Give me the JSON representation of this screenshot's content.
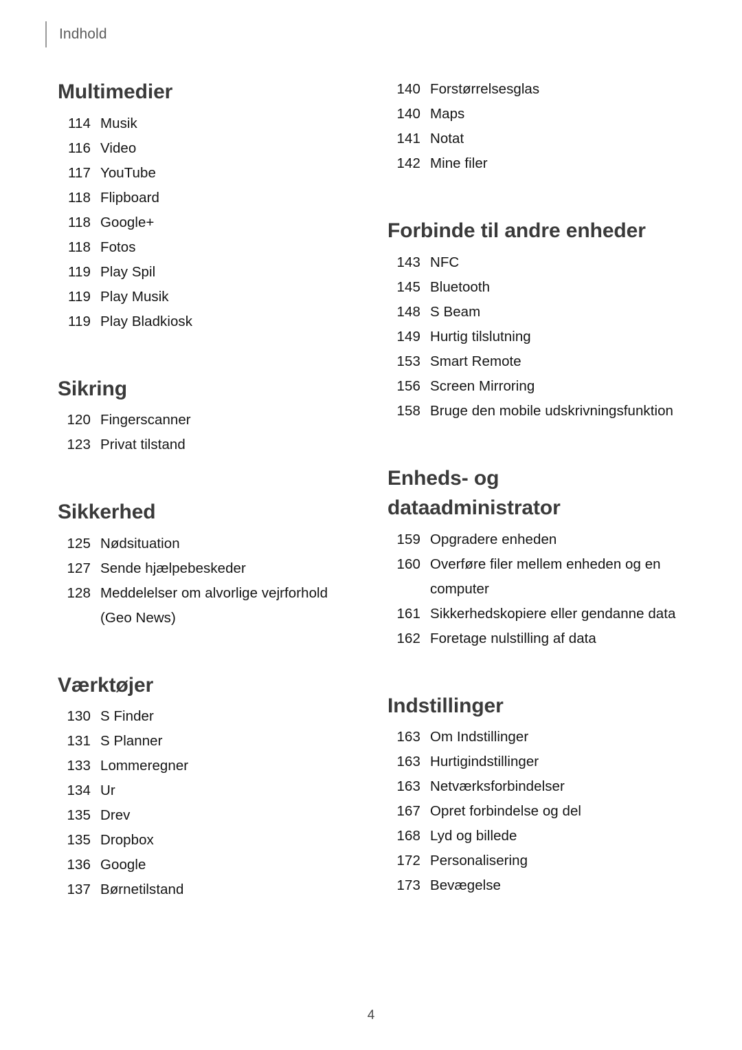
{
  "running_head": {
    "label": "Indhold"
  },
  "folio": {
    "page_number": "4"
  },
  "columns": {
    "left": [
      {
        "title": "Multimedier",
        "entries": [
          {
            "page": "114",
            "title": "Musik"
          },
          {
            "page": "116",
            "title": "Video"
          },
          {
            "page": "117",
            "title": "YouTube"
          },
          {
            "page": "118",
            "title": "Flipboard"
          },
          {
            "page": "118",
            "title": "Google+"
          },
          {
            "page": "118",
            "title": "Fotos"
          },
          {
            "page": "119",
            "title": "Play Spil"
          },
          {
            "page": "119",
            "title": "Play Musik"
          },
          {
            "page": "119",
            "title": "Play Bladkiosk"
          }
        ]
      },
      {
        "title": "Sikring",
        "entries": [
          {
            "page": "120",
            "title": "Fingerscanner"
          },
          {
            "page": "123",
            "title": "Privat tilstand"
          }
        ]
      },
      {
        "title": "Sikkerhed",
        "entries": [
          {
            "page": "125",
            "title": "Nødsituation"
          },
          {
            "page": "127",
            "title": "Sende hjælpebeskeder"
          },
          {
            "page": "128",
            "title": "Meddelelser om alvorlige vejrforhold",
            "continuation": "(Geo News)"
          }
        ]
      },
      {
        "title": "Værktøjer",
        "entries": [
          {
            "page": "130",
            "title": "S Finder"
          },
          {
            "page": "131",
            "title": "S Planner"
          },
          {
            "page": "133",
            "title": "Lommeregner"
          },
          {
            "page": "134",
            "title": "Ur"
          },
          {
            "page": "135",
            "title": "Drev"
          },
          {
            "page": "135",
            "title": "Dropbox"
          },
          {
            "page": "136",
            "title": "Google"
          },
          {
            "page": "137",
            "title": "Børnetilstand"
          }
        ]
      }
    ],
    "right": [
      {
        "title": "",
        "entries": [
          {
            "page": "140",
            "title": "Forstørrelsesglas"
          },
          {
            "page": "140",
            "title": "Maps"
          },
          {
            "page": "141",
            "title": "Notat"
          },
          {
            "page": "142",
            "title": "Mine filer"
          }
        ]
      },
      {
        "title": "Forbinde til andre enheder",
        "entries": [
          {
            "page": "143",
            "title": "NFC"
          },
          {
            "page": "145",
            "title": "Bluetooth"
          },
          {
            "page": "148",
            "title": "S Beam"
          },
          {
            "page": "149",
            "title": "Hurtig tilslutning"
          },
          {
            "page": "153",
            "title": "Smart Remote"
          },
          {
            "page": "156",
            "title": "Screen Mirroring"
          },
          {
            "page": "158",
            "title": "Bruge den mobile udskrivningsfunktion"
          }
        ]
      },
      {
        "title": "Enheds- og\ndataadministrator",
        "entries": [
          {
            "page": "159",
            "title": "Opgradere enheden"
          },
          {
            "page": "160",
            "title": "Overføre filer mellem enheden og en",
            "continuation": "computer"
          },
          {
            "page": "161",
            "title": "Sikkerhedskopiere eller gendanne data"
          },
          {
            "page": "162",
            "title": "Foretage nulstilling af data"
          }
        ]
      },
      {
        "title": "Indstillinger",
        "entries": [
          {
            "page": "163",
            "title": "Om Indstillinger"
          },
          {
            "page": "163",
            "title": "Hurtigindstillinger"
          },
          {
            "page": "163",
            "title": "Netværksforbindelser"
          },
          {
            "page": "167",
            "title": "Opret forbindelse og del"
          },
          {
            "page": "168",
            "title": "Lyd og billede"
          },
          {
            "page": "172",
            "title": "Personalisering"
          },
          {
            "page": "173",
            "title": "Bevægelse"
          }
        ]
      }
    ]
  }
}
